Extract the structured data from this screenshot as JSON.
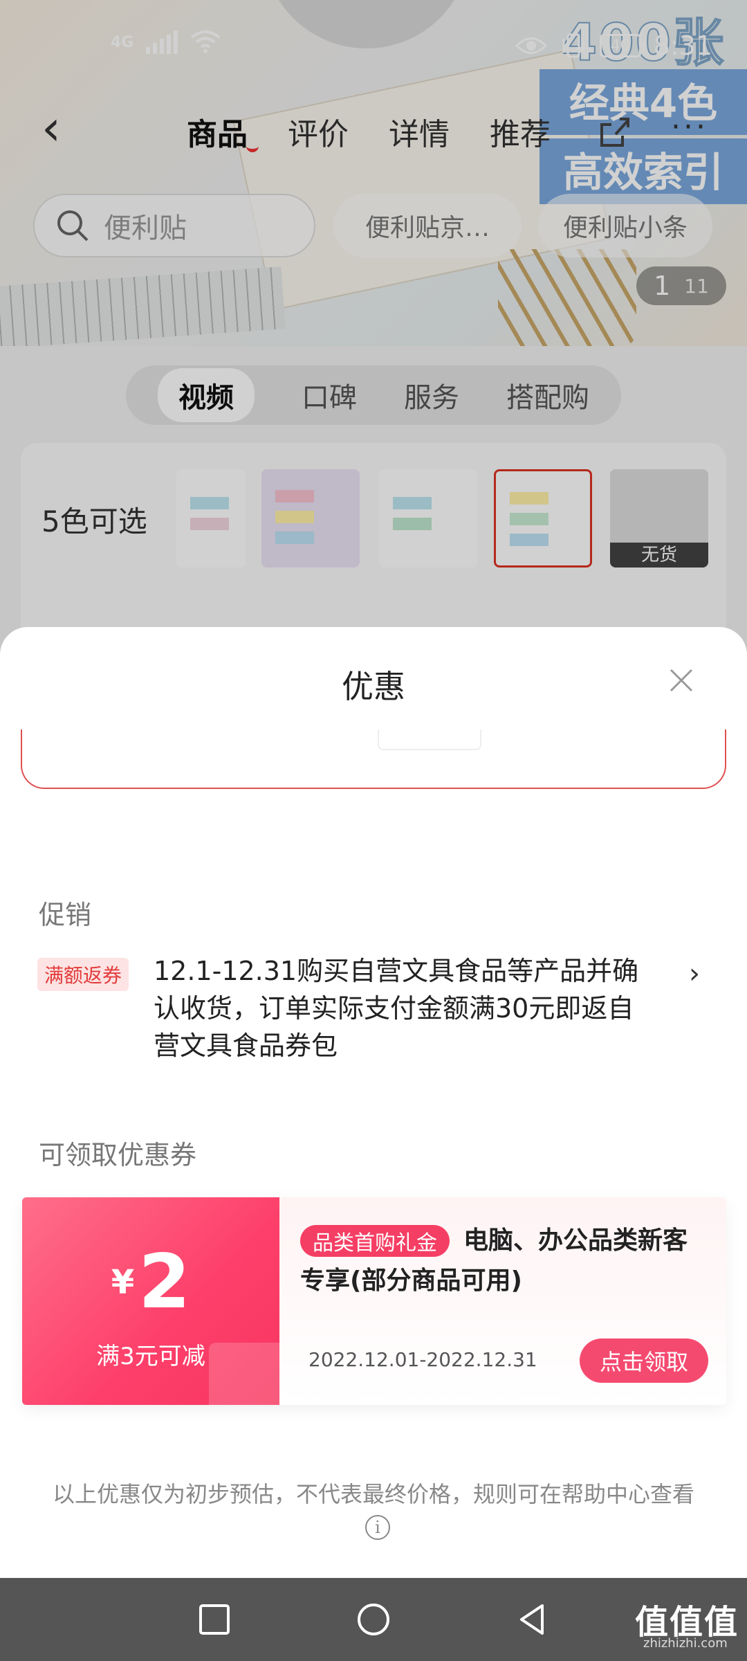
{
  "status_bar": {
    "network": "4G",
    "battery": "40",
    "time": "8:31"
  },
  "hero": {
    "ad_line1": "400张",
    "ad_line2": "经典4色",
    "ad_line3": "高效索引",
    "counter_current": "1",
    "counter_total": "11"
  },
  "nav": {
    "tabs": [
      "商品",
      "评价",
      "详情",
      "推荐"
    ],
    "more": "···"
  },
  "search": {
    "placeholder": "便利贴",
    "chips": [
      "便利贴京…",
      "便利贴小条"
    ]
  },
  "section_tabs": [
    "视频",
    "口碑",
    "服务",
    "搭配购"
  ],
  "variants": {
    "label": "5色可选",
    "out_of_stock": "无货"
  },
  "sheet": {
    "title": "优惠",
    "promo_label": "促销",
    "promo_tag": "满额返券",
    "promo_text": "12.1-12.31购买自营文具食品等产品并确认收货，订单实际支付金额满30元即返自营文具食品券包",
    "coupon_section_label": "可领取优惠券",
    "coupon": {
      "currency": "¥",
      "amount": "2",
      "condition": "满3元可减",
      "badge": "品类首购礼金",
      "title": "电脑、办公品类新客专享(部分商品可用)",
      "date_range": "2022.12.01-2022.12.31",
      "button": "点击领取"
    },
    "disclaimer": "以上优惠仅为初步预估，不代表最终价格，规则可在帮助中心查看"
  },
  "watermark": {
    "brand": "值值值",
    "domain": "zhizhizhi.com"
  },
  "colors": {
    "accent": "#f53e64",
    "promo_red": "#e23b3b"
  }
}
